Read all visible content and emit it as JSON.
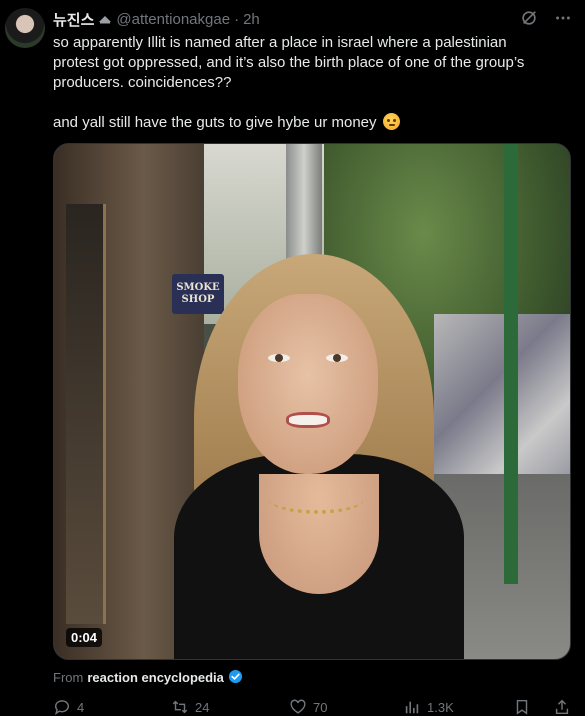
{
  "author": {
    "display_name": "뉴진스",
    "handle": "@attentionakgae",
    "separator": "·",
    "time": "2h"
  },
  "tweet": {
    "text": "so apparently Illit is named after a place in israel where a palestinian protest got oppressed, and it’s also the birth place of one of the group’s producers. coincidences??\n\nand yall still have the guts to give hybe ur money",
    "emoji": "thinking-face-emoji"
  },
  "media": {
    "duration": "0:04",
    "sign_line1": "SMOKE",
    "sign_line2": "SHOP"
  },
  "attribution": {
    "prefix": "From",
    "source": "reaction encyclopedia",
    "verified_color": "#1d9bf0"
  },
  "actions": {
    "replies": "4",
    "reposts": "24",
    "likes": "70",
    "views": "1.3K"
  },
  "colors": {
    "background": "#000000",
    "text_primary": "#e7e9ea",
    "text_secondary": "#71767b"
  }
}
